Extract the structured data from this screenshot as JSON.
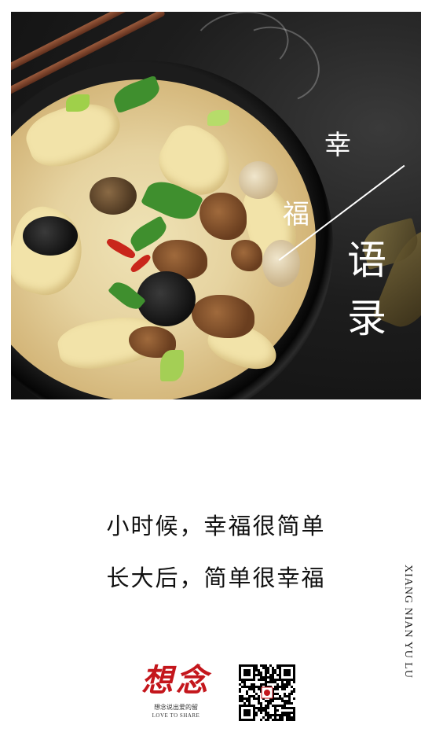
{
  "hero": {
    "image_alt": "food photo",
    "title": {
      "char1": "幸",
      "char2": "福",
      "char3": "语",
      "char4": "录"
    }
  },
  "quote": {
    "line1": "小时候，幸福很简单",
    "line2": "长大后，简单很幸福"
  },
  "side_text": "XIANG NIAN YU LU",
  "logo": {
    "main": "想念",
    "tagline": "想念说出爱的留",
    "english": "LOVE TO SHARE"
  },
  "colors": {
    "brand_red": "#c4161c",
    "text": "#111111",
    "background": "#ffffff"
  }
}
